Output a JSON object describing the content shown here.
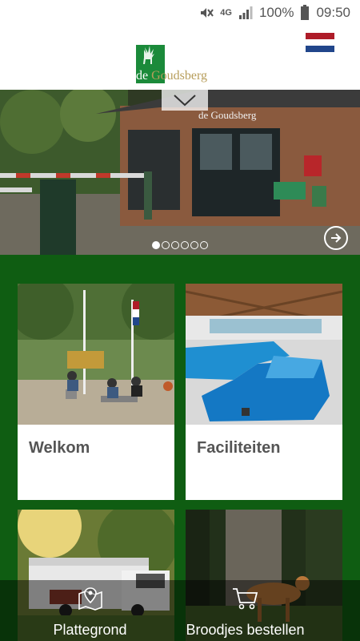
{
  "status_bar": {
    "network": "4G",
    "battery": "100%",
    "time": "09:50"
  },
  "header": {
    "logo_text_de": "de",
    "logo_text_name": " Goudsberg",
    "language_flag": "dutch-flag-icon"
  },
  "hero": {
    "sign_text": "de Goudsberg",
    "slide_count": 6,
    "active_slide": 1
  },
  "cards": [
    {
      "title": "Welkom"
    },
    {
      "title": "Faciliteiten"
    }
  ],
  "bottom_nav": [
    {
      "label": "Plattegrond",
      "icon": "map-pin-icon"
    },
    {
      "label": "Broodjes bestellen",
      "icon": "shopping-cart-icon"
    }
  ],
  "colors": {
    "primary_green": "#0f5d12",
    "logo_green": "#1b8a3a"
  }
}
